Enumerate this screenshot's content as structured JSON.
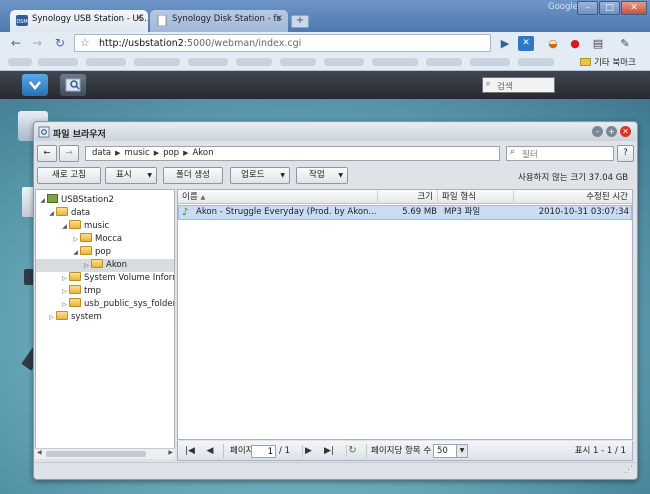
{
  "browser": {
    "tabs": [
      {
        "label": "Synology USB Station - US...",
        "favicon": "dsm-favicon",
        "active": true
      },
      {
        "label": "Synology Disk Station - fs",
        "favicon": "page-icon",
        "active": false
      }
    ],
    "brand": "Google",
    "url_host": "http://usbstation2",
    "url_rest": ":5000/webman/index.cgi",
    "bookmark_folder": "기타 북마크"
  },
  "dsm": {
    "search_placeholder": "검색"
  },
  "file_browser": {
    "title": "파일 브라우저",
    "path": [
      "data",
      "music",
      "pop",
      "Akon"
    ],
    "filter_placeholder": "필터",
    "buttons": {
      "refresh": "새로 고침",
      "view": "표시",
      "new_folder": "폴더 생성",
      "upload": "업로드",
      "action": "작업"
    },
    "available_space": "사용하지 않는 크기 37.04 GB",
    "tree": [
      {
        "label": "USBStation2",
        "depth": 0,
        "expanded": true
      },
      {
        "label": "data",
        "depth": 1,
        "expanded": true
      },
      {
        "label": "music",
        "depth": 2,
        "expanded": true
      },
      {
        "label": "Mocca",
        "depth": 3,
        "expanded": false
      },
      {
        "label": "pop",
        "depth": 3,
        "expanded": true
      },
      {
        "label": "Akon",
        "depth": 4,
        "expanded": false,
        "selected": true
      },
      {
        "label": "System Volume Inform",
        "depth": 2,
        "expanded": false
      },
      {
        "label": "tmp",
        "depth": 2,
        "expanded": false
      },
      {
        "label": "usb_public_sys_folder",
        "depth": 2,
        "expanded": false
      },
      {
        "label": "system",
        "depth": 1,
        "expanded": false
      }
    ],
    "columns": {
      "name": "이름",
      "size": "크기",
      "type": "파일 형식",
      "modified": "수정된 시간"
    },
    "files": [
      {
        "name": "Akon - Struggle Everyday (Prod. by Akon...",
        "size": "5.69 MB",
        "type": "MP3 파일",
        "modified": "2010-10-31 03:07:34"
      }
    ],
    "pager": {
      "page_label": "페이지",
      "page_value": "1",
      "page_total": "/ 1",
      "per_page_label": "페이지당 항목 수",
      "per_page_value": "50",
      "display_info": "표시 1 - 1 / 1"
    }
  },
  "colors": {
    "selection": "#c9dcf4",
    "folder": "#f0c24a",
    "close_button": "#d9341c"
  }
}
